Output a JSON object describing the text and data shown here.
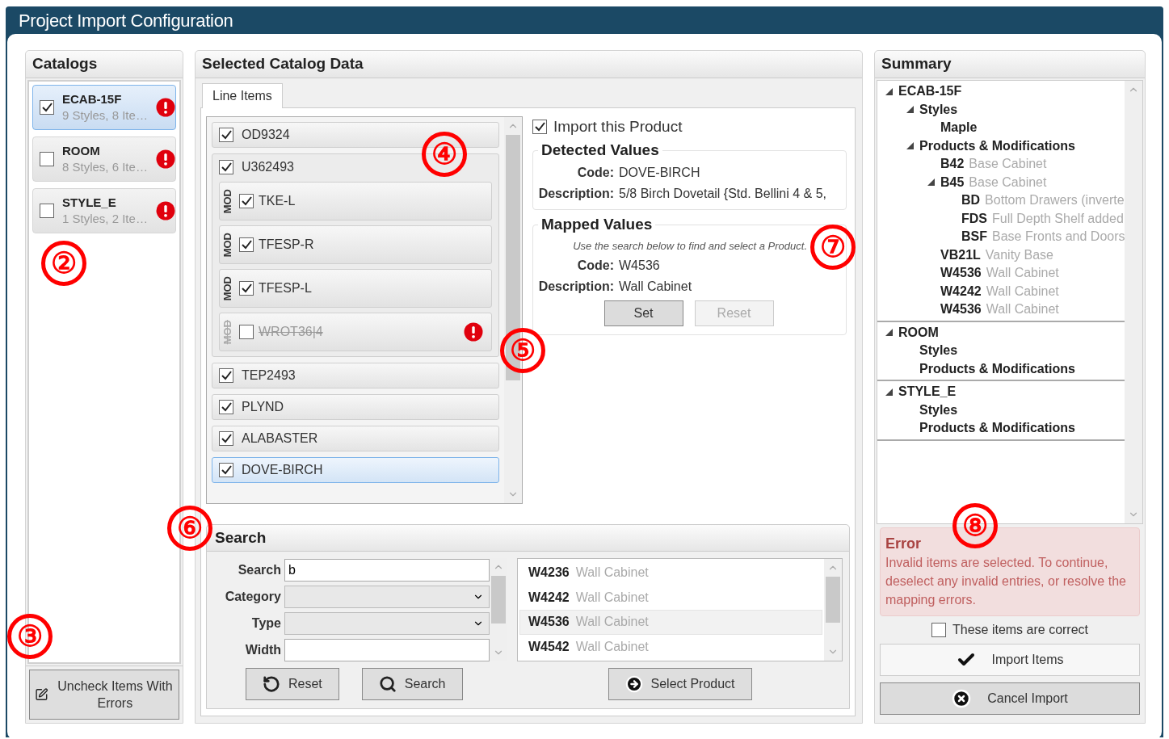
{
  "window": {
    "title": "Project Import Configuration"
  },
  "catalogs": {
    "title": "Catalogs",
    "items": [
      {
        "name": "ECAB-15F",
        "summary": "9 Styles, 8 Ite…",
        "checked": true,
        "selected": true,
        "error": true
      },
      {
        "name": "ROOM",
        "summary": "8 Styles, 6 Ite…",
        "checked": false,
        "selected": false,
        "error": true
      },
      {
        "name": "STYLE_E",
        "summary": "1 Styles, 2 Ite…",
        "checked": false,
        "selected": false,
        "error": true
      }
    ],
    "button": {
      "label": "Uncheck Items With Errors"
    }
  },
  "selected_catalog_data": {
    "title": "Selected Catalog Data",
    "tabs": [
      {
        "label": "Line Items",
        "selected": true
      }
    ],
    "line_items": [
      {
        "code": "OD9324",
        "checked": true,
        "selected": false
      },
      {
        "code": "U362493",
        "checked": true,
        "selected": false,
        "mods": [
          {
            "tag": "MOD",
            "code": "TKE-L",
            "checked": true,
            "invalid": false
          },
          {
            "tag": "MOD",
            "code": "TFESP-R",
            "checked": true,
            "invalid": false
          },
          {
            "tag": "MOD",
            "code": "TFESP-L",
            "checked": true,
            "invalid": false
          },
          {
            "tag": "MOD",
            "code": "WROT36|4",
            "checked": false,
            "invalid": true
          }
        ]
      },
      {
        "code": "TEP2493",
        "checked": true,
        "selected": false
      },
      {
        "code": "PLYND",
        "checked": true,
        "selected": false
      },
      {
        "code": "ALABASTER",
        "checked": true,
        "selected": false
      },
      {
        "code": "DOVE-BIRCH",
        "checked": true,
        "selected": true
      }
    ],
    "details": {
      "import_checkbox": {
        "label": "Import this Product",
        "checked": true
      },
      "detected": {
        "title": "Detected Values",
        "fields": [
          {
            "label": "Code:",
            "value": "DOVE-BIRCH"
          },
          {
            "label": "Description:",
            "value": "5/8 Birch Dovetail {Std. Bellini 4 & 5,"
          }
        ]
      },
      "mapped": {
        "title": "Mapped Values",
        "hint": "Use the search below to find and select a Product.",
        "fields": [
          {
            "label": "Code:",
            "value": "W4536"
          },
          {
            "label": "Description:",
            "value": "Wall Cabinet"
          }
        ],
        "buttons": [
          {
            "label": "Set",
            "disabled": false
          },
          {
            "label": "Reset",
            "disabled": true
          }
        ]
      }
    },
    "search": {
      "title": "Search",
      "fields": [
        {
          "label": "Search",
          "kind": "text",
          "value": "b"
        },
        {
          "label": "Category",
          "kind": "select"
        },
        {
          "label": "Type",
          "kind": "select"
        },
        {
          "label": "Width",
          "kind": "text"
        }
      ],
      "results": [
        {
          "code": "W4236",
          "description": "Wall Cabinet",
          "selected": false
        },
        {
          "code": "W4242",
          "description": "Wall Cabinet",
          "selected": false
        },
        {
          "code": "W4536",
          "description": "Wall Cabinet",
          "selected": true
        },
        {
          "code": "W4542",
          "description": "Wall Cabinet",
          "selected": false
        }
      ],
      "buttons": [
        {
          "kind": "reset",
          "label": "Reset"
        },
        {
          "kind": "search",
          "label": "Search"
        },
        {
          "kind": "select",
          "label": "Select Product"
        }
      ]
    }
  },
  "summary": {
    "title": "Summary",
    "tree": [
      {
        "code": "ECAB-15F",
        "expanded": true,
        "children": [
          {
            "code": "Styles",
            "expanded": true,
            "children": [
              {
                "code": "Maple"
              }
            ]
          },
          {
            "code": "Products & Modifications",
            "expanded": true,
            "children": [
              {
                "code": "B42",
                "description": "Base Cabinet"
              },
              {
                "code": "B45",
                "description": "Base Cabinet",
                "expanded": true,
                "children": [
                  {
                    "code": "BD",
                    "description": "Bottom Drawers (inverte"
                  },
                  {
                    "code": "FDS",
                    "description": "Full Depth Shelf added"
                  },
                  {
                    "code": "BSF",
                    "description": "Base Fronts and Doors"
                  }
                ]
              },
              {
                "code": "VB21L",
                "description": "Vanity Base"
              },
              {
                "code": "W4536",
                "description": "Wall Cabinet"
              },
              {
                "code": "W4242",
                "description": "Wall Cabinet"
              },
              {
                "code": "W4536",
                "description": "Wall Cabinet"
              }
            ]
          }
        ]
      },
      {
        "code": "ROOM",
        "expanded": true,
        "children": [
          {
            "code": "Styles"
          },
          {
            "code": "Products & Modifications"
          }
        ]
      },
      {
        "code": "STYLE_E",
        "expanded": true,
        "children": [
          {
            "code": "Styles"
          },
          {
            "code": "Products & Modifications"
          }
        ]
      }
    ],
    "error": {
      "title": "Error",
      "message": "Invalid items are selected.  To continue, deselect any invalid entries, or resolve the mapping errors."
    },
    "confirm": {
      "label": "These items are correct",
      "checked": false
    },
    "buttons": [
      {
        "kind": "import",
        "label": "Import Items"
      },
      {
        "kind": "cancel",
        "label": "Cancel Import"
      }
    ]
  },
  "callouts": [
    {
      "label": "②"
    },
    {
      "label": "③"
    },
    {
      "label": "④"
    },
    {
      "label": "⑤"
    },
    {
      "label": "⑥"
    },
    {
      "label": "⑦"
    },
    {
      "label": "⑧"
    }
  ]
}
